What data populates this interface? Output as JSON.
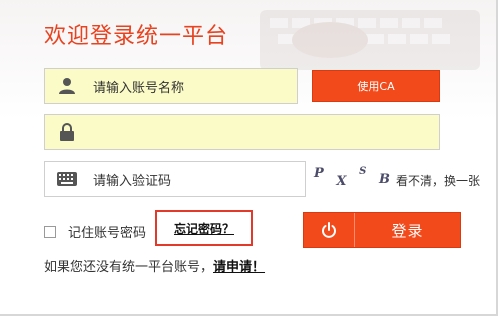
{
  "title": "欢迎登录统一平台",
  "login": {
    "username_placeholder": "请输入账号名称",
    "password_value": "",
    "captcha_placeholder": "请输入验证码",
    "ca_button": "使用CA",
    "captcha_chars": [
      "P",
      "X",
      "S",
      "B"
    ],
    "captcha_refresh": "看不清，换一张",
    "remember_label": "记住账号密码",
    "forgot_link": "忘记密码？",
    "login_button": "登录",
    "register_prompt": "如果您还没有统一平台账号，",
    "register_link": "请申请！"
  },
  "colors": {
    "accent": "#f34a1c",
    "title": "#e8421f",
    "input_fill": "#fbfbc7",
    "highlight_border": "#e23a2a"
  },
  "icons": {
    "username": "user-icon",
    "password": "lock-icon",
    "captcha": "keyboard-icon",
    "login": "power-icon"
  }
}
